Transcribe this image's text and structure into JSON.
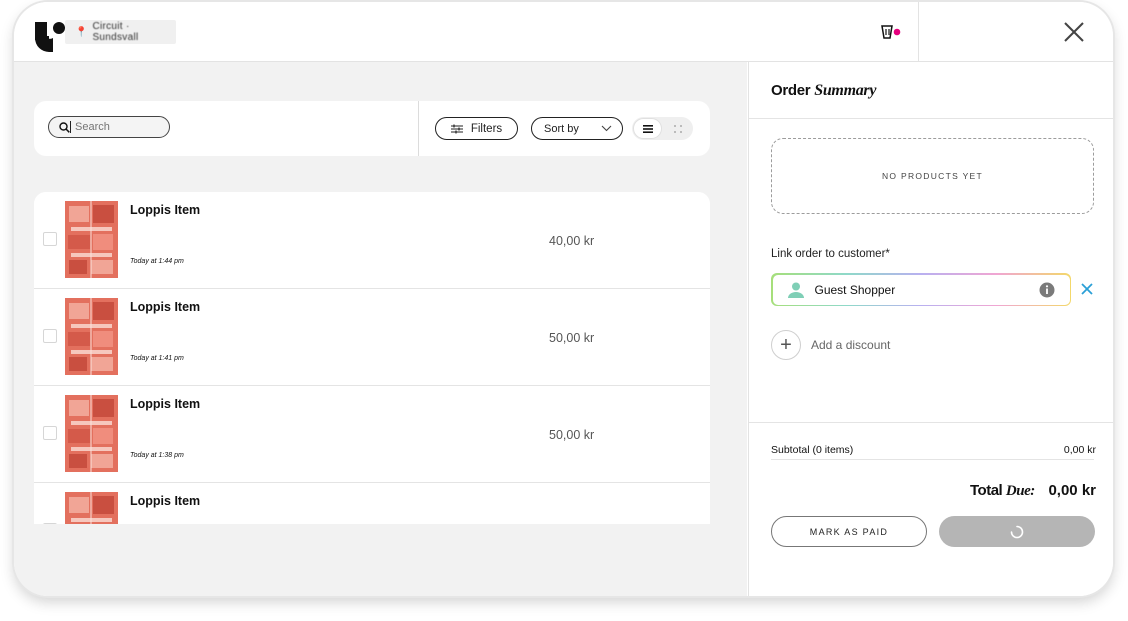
{
  "header": {
    "location": "Circuit · Sundsvall",
    "logo_icon": "brand-logo-icon",
    "cart_icon": "cart-icon",
    "cart_badge_color": "#e6007e",
    "close_icon": "close-icon"
  },
  "search": {
    "placeholder": "Search",
    "value": ""
  },
  "toolbar": {
    "filters_label": "Filters",
    "sort_label": "Sort by",
    "view_mode": "list"
  },
  "products": [
    {
      "name": "Loppis Item",
      "time": "Today at 1:44 pm",
      "price": "40,00 kr"
    },
    {
      "name": "Loppis Item",
      "time": "Today at 1:41 pm",
      "price": "50,00 kr"
    },
    {
      "name": "Loppis Item",
      "time": "Today at 1:38 pm",
      "price": "50,00 kr"
    },
    {
      "name": "Loppis Item",
      "time": "",
      "price": ""
    }
  ],
  "order_summary": {
    "title_plain": "Order",
    "title_italic": "Summary",
    "empty_text": "NO PRODUCTS YET",
    "link_label": "Link order to customer*",
    "customer_name": "Guest Shopper",
    "discount_label": "Add a discount",
    "subtotal_label": "Subtotal (0 items)",
    "subtotal_value": "0,00 kr",
    "total_label_plain": "Total",
    "total_label_italic": "Due:",
    "total_value": "0,00 kr",
    "mark_paid_label": "MARK AS PAID",
    "accent_close_color": "#2a9fd6"
  }
}
